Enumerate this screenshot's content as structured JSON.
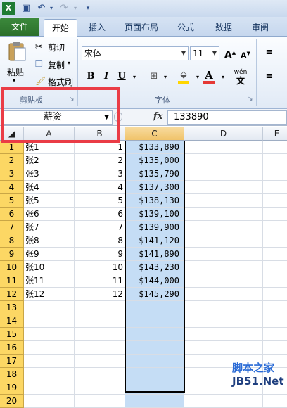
{
  "qat": {
    "icons": [
      "excel-logo-icon",
      "save-icon",
      "undo-icon",
      "redo-icon",
      "customize-icon"
    ]
  },
  "tabs": [
    "文件",
    "开始",
    "插入",
    "页面布局",
    "公式",
    "数据",
    "审阅"
  ],
  "ribbon": {
    "paste_label": "粘贴",
    "cut_label": "剪切",
    "copy_label": "复制",
    "format_painter_label": "格式刷",
    "clipboard_group": "剪贴板",
    "font_name": "宋体",
    "font_size": "11",
    "font_group": "字体",
    "grow_font": "A",
    "shrink_font": "A",
    "bold": "B",
    "italic": "I",
    "underline": "U",
    "font_color_letter": "A",
    "wen_label": "wén",
    "accent_file": "#2e7d32",
    "font_color": "#e53935",
    "fill_color": "#ffd600"
  },
  "formula_bar": {
    "name_box": "薪资",
    "fx": "fx",
    "formula": "133890"
  },
  "columns": [
    "A",
    "B",
    "C",
    "D",
    "E"
  ],
  "rows": [
    {
      "n": "1",
      "a": "张1",
      "b": "1",
      "c": "$133,890"
    },
    {
      "n": "2",
      "a": "张2",
      "b": "2",
      "c": "$135,000"
    },
    {
      "n": "3",
      "a": "张3",
      "b": "3",
      "c": "$135,790"
    },
    {
      "n": "4",
      "a": "张4",
      "b": "4",
      "c": "$137,300"
    },
    {
      "n": "5",
      "a": "张5",
      "b": "5",
      "c": "$138,130"
    },
    {
      "n": "6",
      "a": "张6",
      "b": "6",
      "c": "$139,100"
    },
    {
      "n": "7",
      "a": "张7",
      "b": "7",
      "c": "$139,900"
    },
    {
      "n": "8",
      "a": "张8",
      "b": "8",
      "c": "$141,120"
    },
    {
      "n": "9",
      "a": "张9",
      "b": "9",
      "c": "$141,890"
    },
    {
      "n": "10",
      "a": "张10",
      "b": "10",
      "c": "$143,230"
    },
    {
      "n": "11",
      "a": "张11",
      "b": "11",
      "c": "$144,000"
    },
    {
      "n": "12",
      "a": "张12",
      "b": "12",
      "c": "$145,290"
    },
    {
      "n": "13",
      "a": "",
      "b": "",
      "c": ""
    },
    {
      "n": "14",
      "a": "",
      "b": "",
      "c": ""
    },
    {
      "n": "15",
      "a": "",
      "b": "",
      "c": ""
    },
    {
      "n": "16",
      "a": "",
      "b": "",
      "c": ""
    },
    {
      "n": "17",
      "a": "",
      "b": "",
      "c": ""
    },
    {
      "n": "18",
      "a": "",
      "b": "",
      "c": ""
    },
    {
      "n": "19",
      "a": "",
      "b": "",
      "c": ""
    },
    {
      "n": "20",
      "a": "",
      "b": "",
      "c": ""
    }
  ],
  "watermark": {
    "line1": "脚本之家",
    "line2": "JB51.Net"
  },
  "highlight_color": "#ea3c46"
}
